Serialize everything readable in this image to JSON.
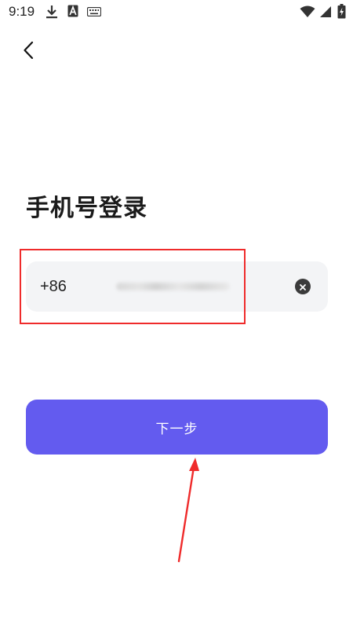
{
  "status_bar": {
    "time": "9:19",
    "icons": [
      "download-icon",
      "a-icon",
      "keyboard-icon",
      "wifi-icon",
      "signal-icon",
      "battery-icon"
    ]
  },
  "header": {
    "back_icon": "chevron-left-icon"
  },
  "main": {
    "title": "手机号登录",
    "phone": {
      "country_code": "+86",
      "value": "",
      "clear_icon": "clear-icon"
    },
    "next_label": "下一步"
  },
  "colors": {
    "primary": "#635bef",
    "field_bg": "#f3f4f6",
    "annotation_red": "#ef2b2b"
  }
}
